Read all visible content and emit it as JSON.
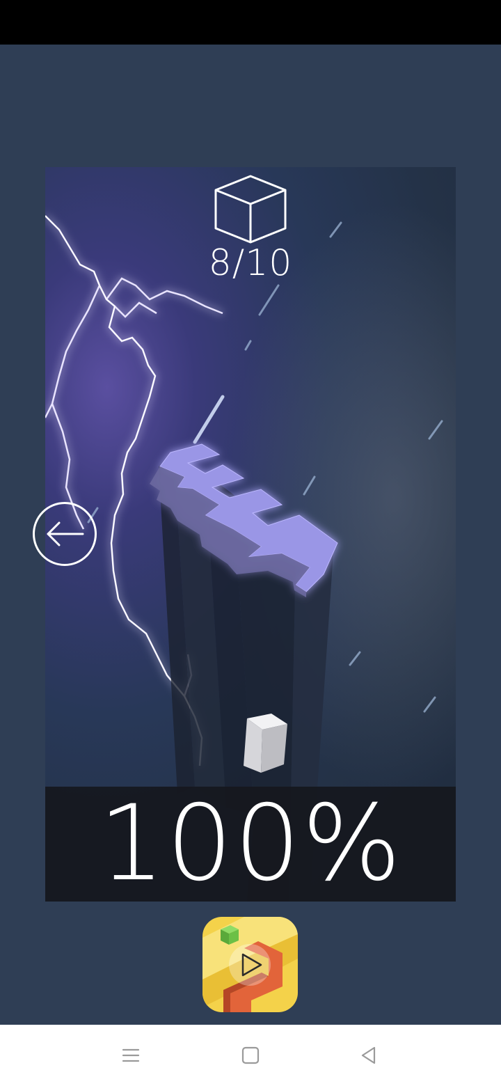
{
  "game": {
    "cube_counter": "8/10",
    "progress_label": "100%",
    "progress_percent": 100
  },
  "icons": {
    "cube": "cube-outline-icon",
    "back": "arrow-left-icon",
    "play": "play-icon",
    "menu": "menu-icon",
    "home": "square-home-icon",
    "back_nav": "triangle-back-icon"
  },
  "colors": {
    "background": "#2f3e55",
    "track": "#8f8ad8",
    "text": "#ffffff",
    "icon_yellow": "#f4d24a",
    "icon_orange": "#e2643a",
    "icon_green": "#6cc046"
  }
}
